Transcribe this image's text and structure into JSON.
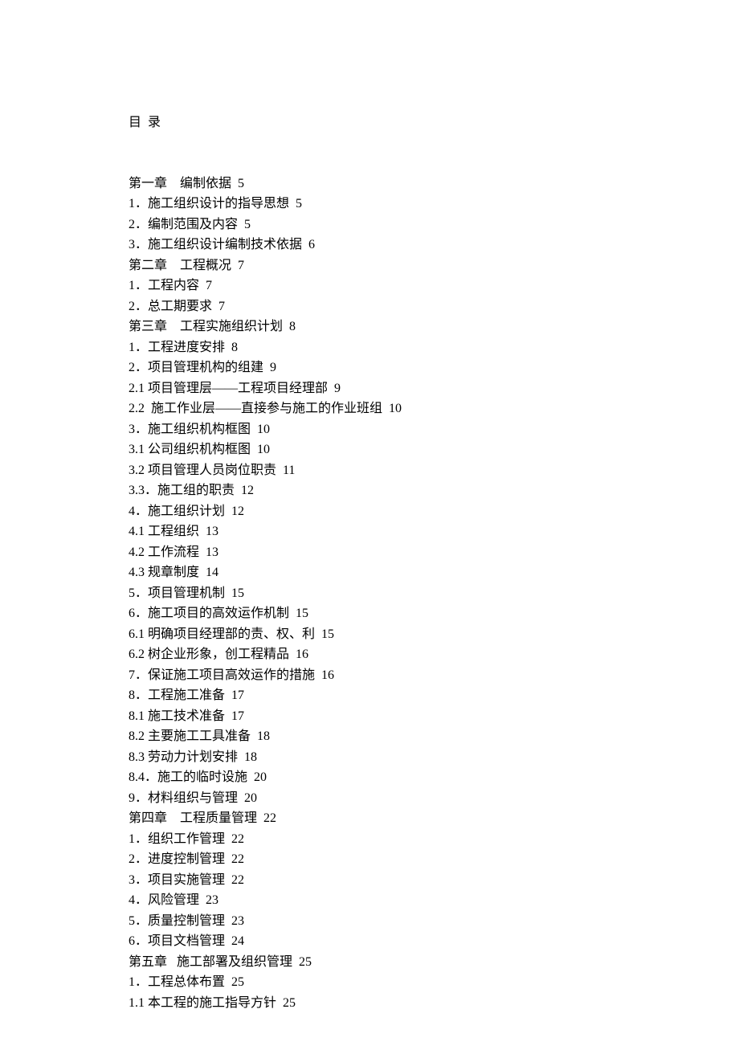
{
  "title": "目   录",
  "toc": [
    {
      "label": "第一章    编制依据",
      "page": "5"
    },
    {
      "label": "1．施工组织设计的指导思想",
      "page": "5"
    },
    {
      "label": "2．编制范围及内容",
      "page": "5"
    },
    {
      "label": "3．施工组织设计编制技术依据",
      "page": "6"
    },
    {
      "label": "第二章    工程概况",
      "page": "7"
    },
    {
      "label": "1．工程内容",
      "page": "7"
    },
    {
      "label": "2．总工期要求",
      "page": "7"
    },
    {
      "label": "第三章    工程实施组织计划",
      "page": "8"
    },
    {
      "label": "1．工程进度安排",
      "page": "8"
    },
    {
      "label": "2．项目管理机构的组建",
      "page": "9"
    },
    {
      "label": "2.1 项目管理层——工程项目经理部",
      "page": "9"
    },
    {
      "label": "2.2  施工作业层——直接参与施工的作业班组",
      "page": "10"
    },
    {
      "label": "3．施工组织机构框图",
      "page": "10"
    },
    {
      "label": "3.1 公司组织机构框图",
      "page": "10"
    },
    {
      "label": "3.2 项目管理人员岗位职责",
      "page": "11"
    },
    {
      "label": "3.3．施工组的职责",
      "page": "12"
    },
    {
      "label": "4．施工组织计划",
      "page": "12"
    },
    {
      "label": "4.1 工程组织",
      "page": "13"
    },
    {
      "label": "4.2 工作流程",
      "page": "13"
    },
    {
      "label": "4.3 规章制度",
      "page": "14"
    },
    {
      "label": "5．项目管理机制",
      "page": "15"
    },
    {
      "label": "6．施工项目的高效运作机制",
      "page": "15"
    },
    {
      "label": "6.1 明确项目经理部的责、权、利",
      "page": "15"
    },
    {
      "label": "6.2 树企业形象，创工程精品",
      "page": "16"
    },
    {
      "label": "7．保证施工项目高效运作的措施",
      "page": "16"
    },
    {
      "label": "8．工程施工准备",
      "page": "17"
    },
    {
      "label": "8.1 施工技术准备",
      "page": "17"
    },
    {
      "label": "8.2 主要施工工具准备",
      "page": "18"
    },
    {
      "label": "8.3 劳动力计划安排",
      "page": "18"
    },
    {
      "label": "8.4．施工的临时设施",
      "page": "20"
    },
    {
      "label": "9．材料组织与管理",
      "page": "20"
    },
    {
      "label": "第四章    工程质量管理",
      "page": "22"
    },
    {
      "label": "1．组织工作管理",
      "page": "22"
    },
    {
      "label": "2．进度控制管理",
      "page": "22"
    },
    {
      "label": "3．项目实施管理",
      "page": "22"
    },
    {
      "label": "4．风险管理",
      "page": "23"
    },
    {
      "label": "5．质量控制管理",
      "page": "23"
    },
    {
      "label": "6．项目文档管理",
      "page": "24"
    },
    {
      "label": "第五章   施工部署及组织管理",
      "page": "25"
    },
    {
      "label": "1．工程总体布置",
      "page": "25"
    },
    {
      "label": "1.1 本工程的施工指导方针",
      "page": "25"
    }
  ]
}
